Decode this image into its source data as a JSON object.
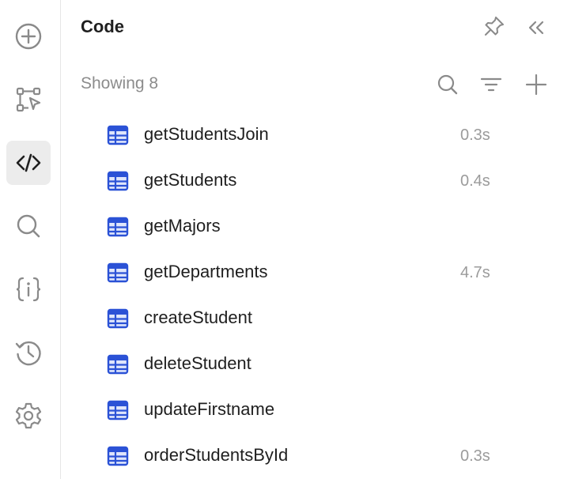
{
  "panel": {
    "title": "Code",
    "showing": "Showing 8"
  },
  "rail": {
    "items": [
      {
        "icon": "plus-circle-icon"
      },
      {
        "icon": "workflow-icon"
      },
      {
        "icon": "code-icon",
        "active": true
      },
      {
        "icon": "search-icon"
      },
      {
        "icon": "variables-icon"
      },
      {
        "icon": "history-icon"
      },
      {
        "icon": "settings-icon"
      }
    ]
  },
  "queries": [
    {
      "name": "getStudentsJoin",
      "duration": "0.3s"
    },
    {
      "name": "getStudents",
      "duration": "0.4s"
    },
    {
      "name": "getMajors",
      "duration": ""
    },
    {
      "name": "getDepartments",
      "duration": "4.7s"
    },
    {
      "name": "createStudent",
      "duration": ""
    },
    {
      "name": "deleteStudent",
      "duration": ""
    },
    {
      "name": "updateFirstname",
      "duration": ""
    },
    {
      "name": "orderStudentsById",
      "duration": "0.3s"
    }
  ],
  "colors": {
    "accent": "#2b52d6",
    "icon_gray": "#8a8a8a",
    "muted_text": "#9b9b9b"
  }
}
